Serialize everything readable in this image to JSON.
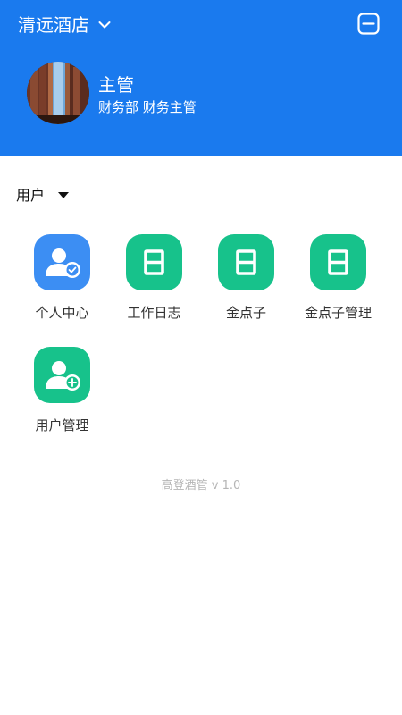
{
  "header": {
    "hotel_name": "清远酒店",
    "menu_icon": "minus-square-icon",
    "background_color": "#1a7aee"
  },
  "user": {
    "name": "主管",
    "department_role": "财务部 财务主管"
  },
  "section": {
    "label": "用户"
  },
  "tiles": [
    {
      "label": "个人中心",
      "icon": "user-check-icon",
      "color": "#3c8ef3"
    },
    {
      "label": "工作日志",
      "icon": "calendar-ri-icon",
      "icon_text": "日",
      "color": "#17c28b"
    },
    {
      "label": "金点子",
      "icon": "calendar-ri-icon",
      "icon_text": "日",
      "color": "#17c28b"
    },
    {
      "label": "金点子管理",
      "icon": "calendar-ri-icon",
      "icon_text": "日",
      "color": "#17c28b"
    },
    {
      "label": "用户管理",
      "icon": "user-add-icon",
      "color": "#17c28b"
    }
  ],
  "footer": {
    "version": "高登酒管 v 1.0"
  }
}
